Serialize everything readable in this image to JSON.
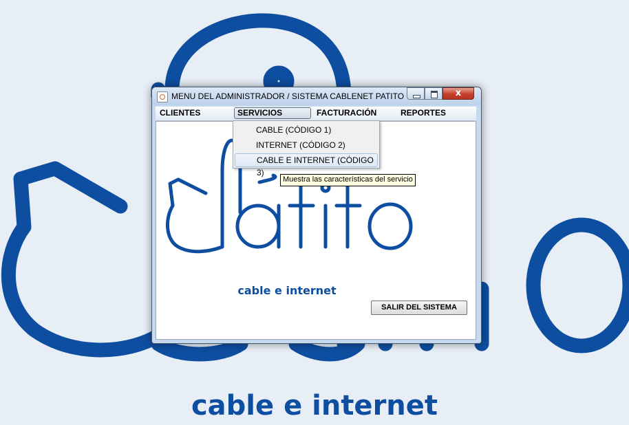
{
  "window": {
    "title": "MENU DEL ADMINISTRADOR / SISTEMA CABLENET PATITO",
    "controls": {
      "minimize": "minimize",
      "maximize": "maximize",
      "close": "x"
    }
  },
  "menubar": {
    "items": [
      {
        "label": "CLIENTES"
      },
      {
        "label": "SERVICIOS",
        "state": "open"
      },
      {
        "label": "FACTURACIÓN"
      },
      {
        "label": "REPORTES"
      }
    ]
  },
  "servicios_menu": {
    "items": [
      {
        "label": "CABLE (CÓDIGO 1)"
      },
      {
        "label": "INTERNET (CÓDIGO 2)"
      },
      {
        "label": "CABLE E INTERNET (CÓDIGO 3)",
        "state": "highlighted"
      }
    ]
  },
  "tooltip": {
    "text": "Muestra las características del servicio"
  },
  "content": {
    "logo_text": "patito",
    "tagline": "cable e internet",
    "exit_button": "SALIR DEL SISTEMA"
  },
  "background": {
    "logo_text": "patito",
    "tagline": "cable e internet"
  },
  "colors": {
    "brand_blue": "#0e4ea0",
    "desktop_bg": "#e8eef6",
    "close_button": "#c4402b",
    "tooltip_bg": "#ffffe1"
  }
}
